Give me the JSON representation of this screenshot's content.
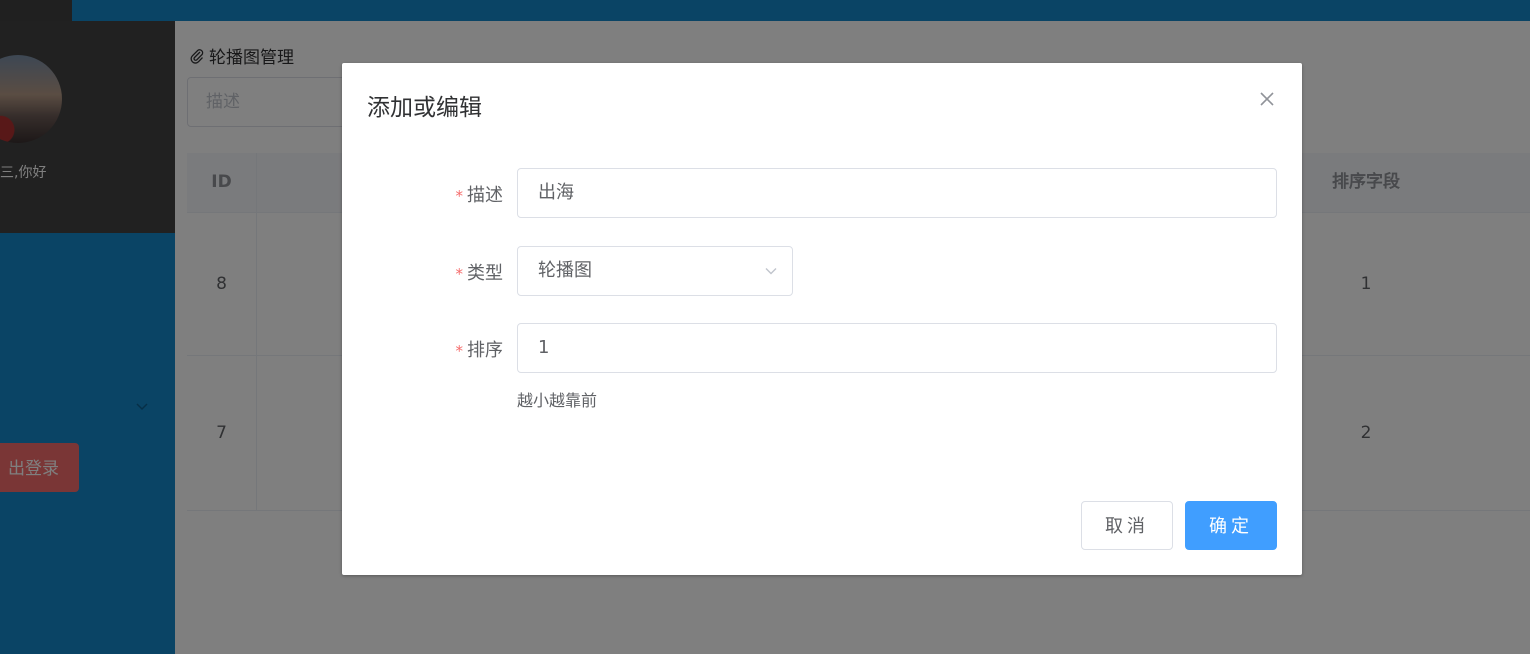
{
  "sidebar": {
    "greeting": "三,你好",
    "logout_label": "出登录"
  },
  "main": {
    "title": "轮播图管理",
    "search_placeholder": "描述",
    "table": {
      "headers": {
        "id": "ID",
        "sort": "排序字段"
      },
      "rows": [
        {
          "id": "8",
          "sort": "1"
        },
        {
          "id": "7",
          "sort": "2"
        }
      ]
    }
  },
  "dialog": {
    "title": "添加或编辑",
    "fields": {
      "desc": {
        "label": "描述",
        "value": "出海"
      },
      "type": {
        "label": "类型",
        "value": "轮播图"
      },
      "sort": {
        "label": "排序",
        "value": "1",
        "hint": "越小越靠前"
      }
    },
    "required_mark": "*",
    "cancel_label": "取消",
    "ok_label": "确定"
  },
  "colors": {
    "primary": "#409eff",
    "danger": "#f56c6c",
    "sidebar": "#1489ca"
  }
}
